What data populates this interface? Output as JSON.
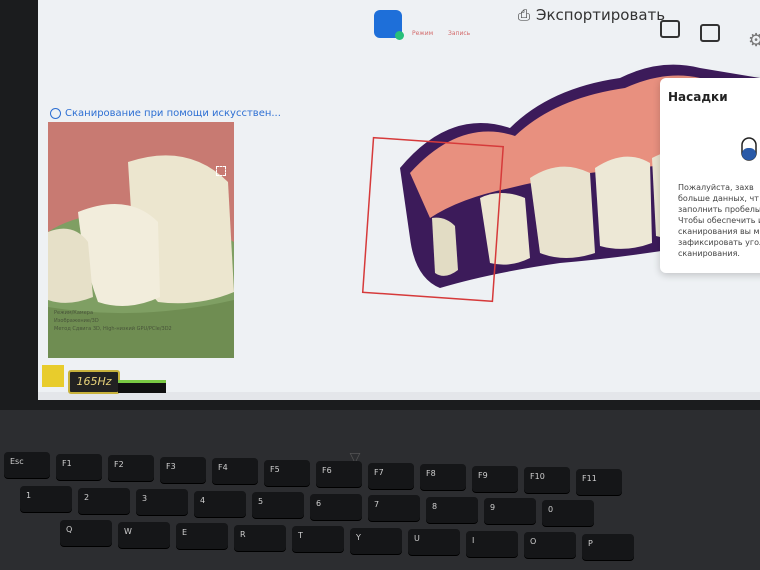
{
  "toolbar": {
    "export_label": "Экспортировать",
    "mini_labels": [
      "Режим",
      "Запись"
    ]
  },
  "ai_scan": {
    "title": "Сканирование при помощи искусствен...",
    "overlay_text": [
      "Режим/Камера",
      "Изображение/3D",
      "Метод Сдвига 3D, High-низкий GPU/PCle/3D2"
    ]
  },
  "nozzle_panel": {
    "title": "Насадки",
    "instructions": "Пожалуйста, захв\nбольше данных, чт\nзаполнить пробелы\nЧтобы обеспечить и\nсканирования вы мо\nзафиксировать угол\nсканирования."
  },
  "hardware": {
    "refresh_badge": "165Hz"
  },
  "keyboard": {
    "keys": [
      "Esc",
      "F1",
      "F2",
      "F3",
      "F4",
      "F5",
      "F6",
      "F7",
      "F8",
      "F9",
      "F10",
      "F11",
      "1",
      "2",
      "3",
      "4",
      "5",
      "6",
      "7",
      "8",
      "9",
      "0",
      "Q",
      "W",
      "E",
      "R",
      "T",
      "Y",
      "U",
      "I",
      "O",
      "P"
    ]
  },
  "colors": {
    "accent": "#2d6fd3",
    "scan_box": "#d63a3a",
    "gum": "#e8907f"
  }
}
